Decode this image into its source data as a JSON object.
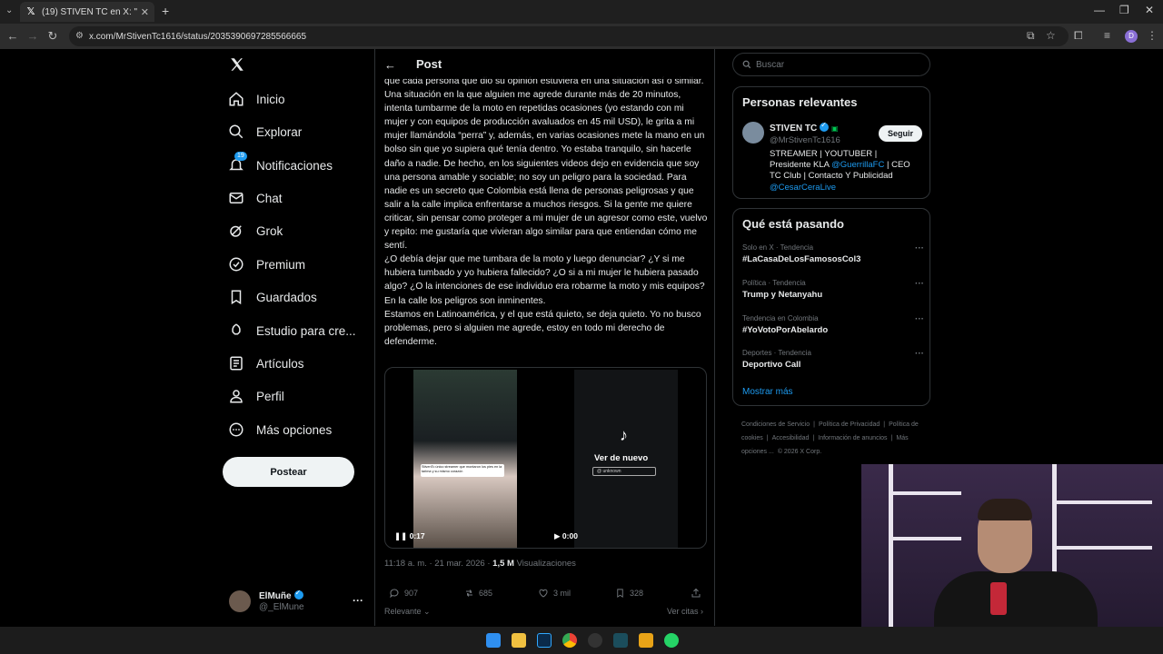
{
  "browser": {
    "tab_title": "(19) STIVEN TC en X: \"Todo el m",
    "url": "x.com/MrStivenTc1616/status/2035390697285566665"
  },
  "nav": {
    "items": [
      {
        "label": "Inicio",
        "icon": "home-icon"
      },
      {
        "label": "Explorar",
        "icon": "search-icon"
      },
      {
        "label": "Notificaciones",
        "icon": "bell-icon",
        "badge": "19"
      },
      {
        "label": "Chat",
        "icon": "mail-icon"
      },
      {
        "label": "Grok",
        "icon": "grok-icon"
      },
      {
        "label": "Premium",
        "icon": "premium-icon"
      },
      {
        "label": "Guardados",
        "icon": "bookmark-icon"
      },
      {
        "label": "Estudio para cre...",
        "icon": "rocket-icon"
      },
      {
        "label": "Artículos",
        "icon": "article-icon"
      },
      {
        "label": "Perfil",
        "icon": "person-icon"
      },
      {
        "label": "Más opciones",
        "icon": "more-circle-icon"
      }
    ],
    "post_button": "Postear",
    "account": {
      "name": "ElMuñe",
      "handle": "@_ElMune"
    }
  },
  "post": {
    "header": "Post",
    "paragraphs": [
      "que cada persona que dio su opinión estuviera en una situación así o similar. Una situación en la que alguien me agrede durante más de 20 minutos, intenta tumbarme de la moto en repetidas ocasiones (yo estando con mi mujer y con equipos de producción avaluados en 45 mil USD), le grita a mi mujer llamándola “perra” y, además, en varias ocasiones mete la mano en un bolso sin que yo supiera qué tenía dentro. Yo estaba tranquilo, sin hacerle daño a nadie. De hecho, en los siguientes videos dejo en evidencia que soy una persona amable y sociable; no soy un peligro para la sociedad. Para nadie es un secreto que Colombia está llena de personas peligrosas y que salir a la calle implica enfrentarse a muchos riesgos. Si la gente me quiere criticar, sin pensar como proteger a mi mujer de un agresor como este, vuelvo y repito: me gustaría que vivieran algo similar para que entiendan cómo me sentí.",
      "¿O debía dejar que me tumbara de la moto y luego denunciar? ¿Y si me hubiera tumbado y yo hubiera fallecido? ¿O si a mi mujer le hubiera pasado algo? ¿O la intenciones de ese individuo era robarme la moto y mis equipos? En la calle los peligros son inminentes.",
      "Estamos en Latinoamérica, y el que está quieto, se deja quieto. Yo no busco problemas, pero si alguien me agrede, estoy en todo mi derecho de defenderme."
    ],
    "video1": {
      "time": "0:17",
      "caption": "StivenTc único streamer que montaron los pies en la tarima y su mismo corazón"
    },
    "video2": {
      "time": "0:00",
      "replay": "Ver de nuevo",
      "bar_text": "@ unknown"
    },
    "timestamp": "11:18 a. m. · 21 mar. 2026 · ",
    "views_count": "1,5 M",
    "views_label": " Visualizaciones",
    "replies": "907",
    "reposts": "685",
    "likes": "3 mil",
    "bookmarks": "328",
    "sort_label": "Relevante",
    "quotes_label": "Ver citas"
  },
  "right": {
    "search_placeholder": "Buscar",
    "relevant": {
      "title": "Personas relevantes",
      "name": "STIVEN TC",
      "handle": "@MrStivenTc1616",
      "follow": "Seguir",
      "bio_1": "STREAMER | YOUTUBER | Presidente KLA ",
      "bio_link1": "@GuerrillaFC",
      "bio_2": " | CEO TC Club | Contacto Y Publicidad",
      "bio_link2": "@CesarCeraLive"
    },
    "trends": {
      "title": "Qué está pasando",
      "items": [
        {
          "context": "Solo en X · Tendencia",
          "topic": "#LaCasaDeLosFamososCol3"
        },
        {
          "context": "Política · Tendencia",
          "topic": "Trump y Netanyahu"
        },
        {
          "context": "Tendencia en Colombia",
          "topic": "#YoVotoPorAbelardo"
        },
        {
          "context": "Deportes · Tendencia",
          "topic": "Deportivo Call"
        }
      ],
      "more": "Mostrar más"
    },
    "footer": {
      "items": [
        "Condiciones de Servicio",
        "|",
        "Política de Privacidad",
        "|",
        "Política de cookies",
        "|",
        "Accesibilidad",
        "|",
        "Información de anuncios",
        "|",
        "Más opciones ...",
        "© 2026 X Corp."
      ]
    }
  },
  "colors": {
    "accent": "#1d9bf0",
    "background": "#000000",
    "border": "#2f3336",
    "muted": "#71767b"
  }
}
